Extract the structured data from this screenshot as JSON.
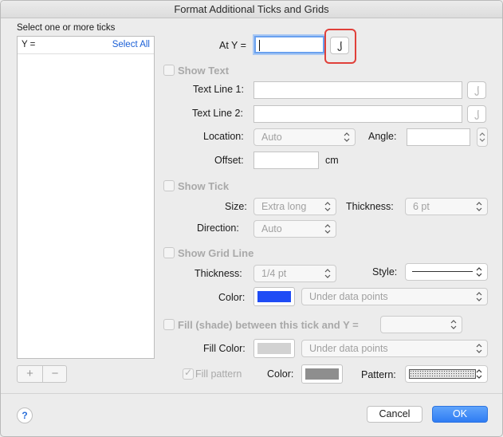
{
  "window": {
    "title": "Format Additional Ticks and Grids"
  },
  "list": {
    "header": "Select one or more ticks",
    "col_label": "Y =",
    "select_all": "Select All",
    "add": "+",
    "remove": "−"
  },
  "at_y": {
    "label": "At Y =",
    "value": ""
  },
  "show_text": {
    "label": "Show Text",
    "checked": false,
    "text_line1_label": "Text Line 1:",
    "text_line2_label": "Text Line 2:",
    "location_label": "Location:",
    "location_value": "Auto",
    "angle_label": "Angle:",
    "offset_label": "Offset:",
    "offset_unit": "cm"
  },
  "show_tick": {
    "label": "Show Tick",
    "checked": false,
    "size_label": "Size:",
    "size_value": "Extra long",
    "thickness_label": "Thickness:",
    "thickness_value": "6 pt",
    "direction_label": "Direction:",
    "direction_value": "Auto"
  },
  "show_grid": {
    "label": "Show Grid Line",
    "checked": false,
    "thickness_label": "Thickness:",
    "thickness_value": "1/4 pt",
    "style_label": "Style:",
    "color_label": "Color:",
    "color_hex": "#1f4cf5",
    "order_value": "Under data points"
  },
  "fill": {
    "label": "Fill (shade) between this tick and Y =",
    "checked": false,
    "fill_color_label": "Fill Color:",
    "fill_color_hex": "#d2d2d2",
    "order_value": "Under data points",
    "fill_pattern_label": "Fill pattern",
    "fill_pattern_checked": true,
    "color_label": "Color:",
    "pattern_color_hex": "#8e8e8e",
    "pattern_label": "Pattern:"
  },
  "buttons": {
    "help": "?",
    "cancel": "Cancel",
    "ok": "OK"
  },
  "colors": {
    "accent": "#2f7cf3",
    "highlight": "#e0403a"
  }
}
